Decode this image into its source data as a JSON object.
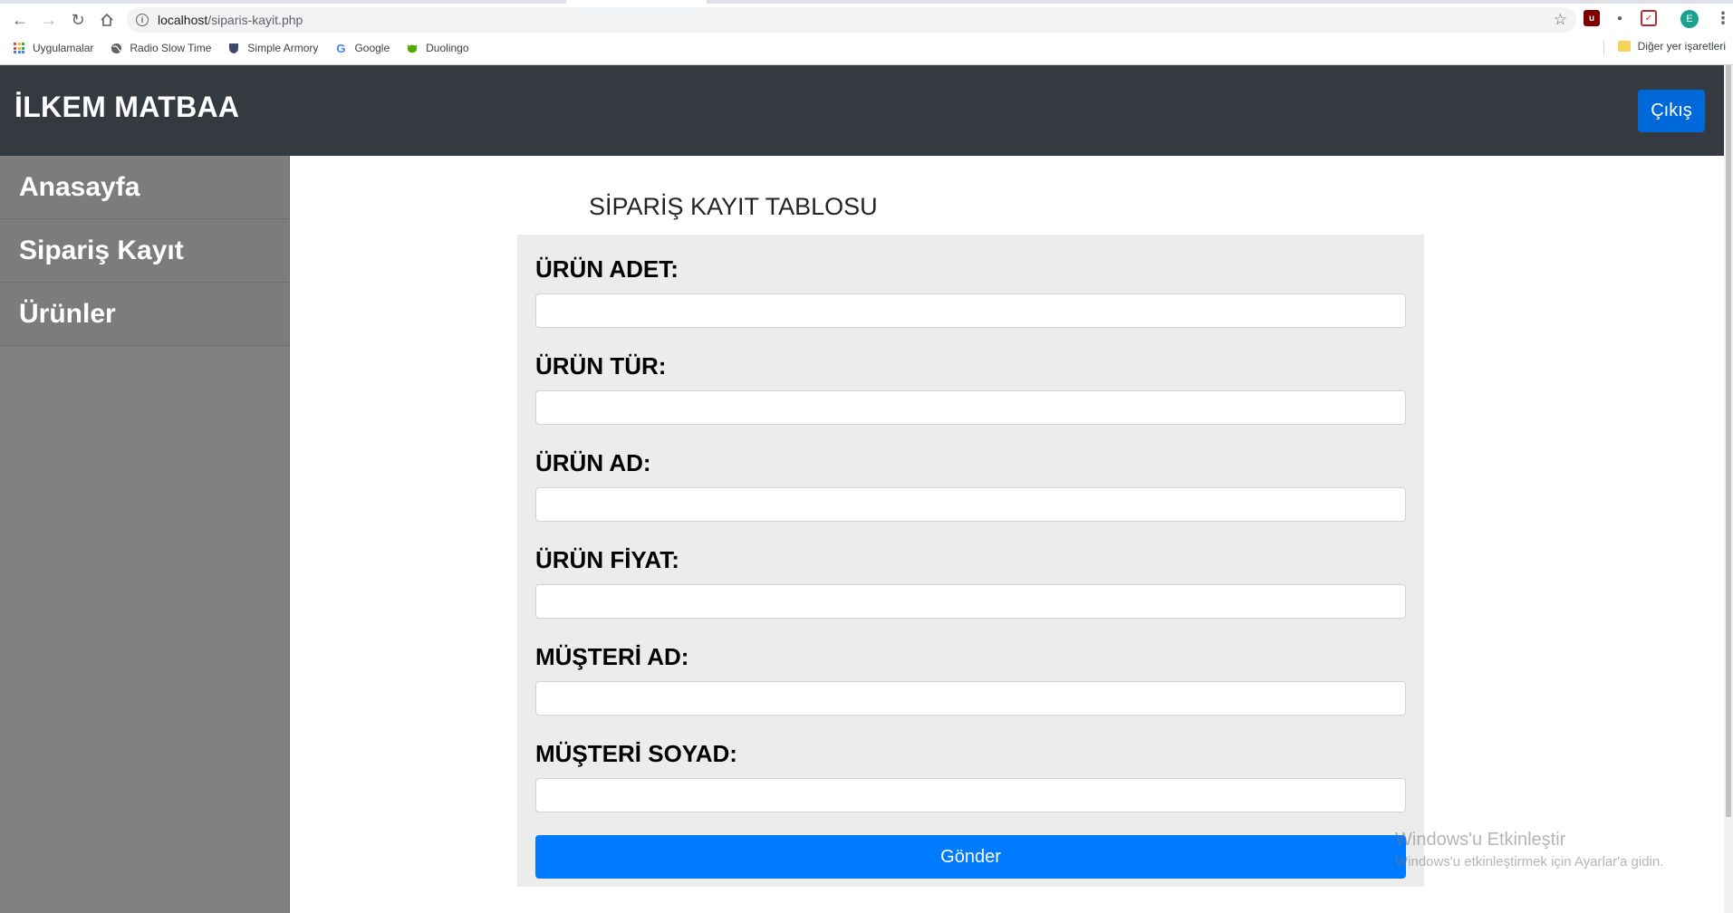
{
  "browser": {
    "url_host": "localhost",
    "url_path": "/siparis-kayit.php",
    "profile_initial": "E",
    "bookmarks": [
      {
        "label": "Uygulamalar",
        "icon": "apps-grid-icon"
      },
      {
        "label": "Radio Slow Time",
        "icon": "globe-icon"
      },
      {
        "label": "Simple Armory",
        "icon": "shield-icon"
      },
      {
        "label": "Google",
        "icon": "google-icon"
      },
      {
        "label": "Duolingo",
        "icon": "duolingo-icon"
      }
    ],
    "other_bookmarks": "Diğer yer işaretleri"
  },
  "navbar": {
    "brand": "İLKEM MATBAA",
    "logout_label": "Çıkış",
    "background": "#343a40",
    "logout_color": "#0069d9"
  },
  "sidebar": {
    "items": [
      {
        "label": "Anasayfa"
      },
      {
        "label": "Sipariş Kayıt"
      },
      {
        "label": "Ürünler"
      }
    ],
    "background": "#808080"
  },
  "form": {
    "title": "SİPARİŞ KAYIT TABLOSU",
    "fields": [
      {
        "label": "ÜRÜN ADET:",
        "value": ""
      },
      {
        "label": "ÜRÜN TÜR:",
        "value": ""
      },
      {
        "label": "ÜRÜN AD:",
        "value": ""
      },
      {
        "label": "ÜRÜN FİYAT:",
        "value": ""
      },
      {
        "label": "MÜŞTERİ AD:",
        "value": ""
      },
      {
        "label": "MÜŞTERİ SOYAD:",
        "value": ""
      }
    ],
    "submit_label": "Gönder",
    "submit_color": "#007bff"
  },
  "watermark": {
    "line1": "Windows'u Etkinleştir",
    "line2": "Windows'u etkinleştirmek için Ayarlar'a gidin."
  }
}
